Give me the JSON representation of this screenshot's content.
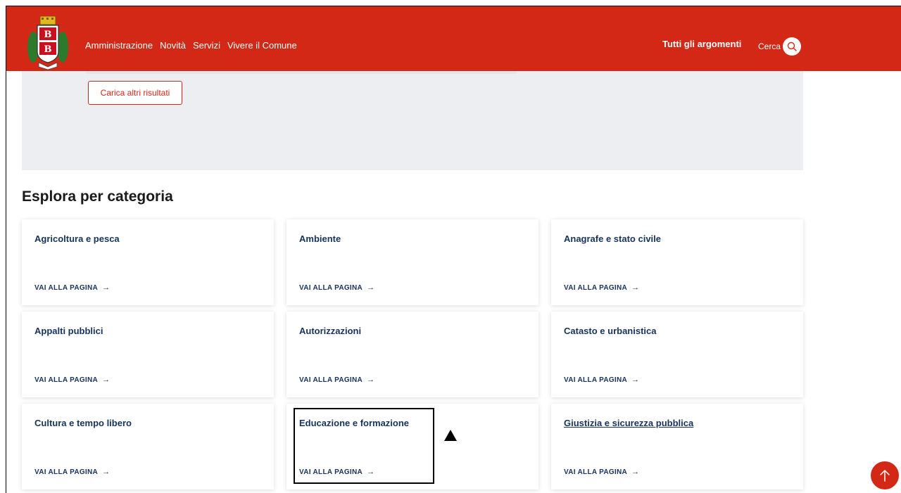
{
  "header": {
    "nav": [
      "Amministrazione",
      "Novità",
      "Servizi",
      "Vivere il Comune"
    ],
    "topics_label": "Tutti gli argomenti",
    "search_label": "Cerca",
    "logo_letters": [
      "B",
      "B"
    ],
    "brand_color": "#d42816"
  },
  "results": {
    "load_more_label": "Carica altri risultati"
  },
  "section_title": "Esplora per categoria",
  "cards": [
    {
      "title": "Agricoltura e pesca",
      "link": "VAI ALLA PAGINA"
    },
    {
      "title": "Ambiente",
      "link": "VAI ALLA PAGINA"
    },
    {
      "title": "Anagrafe e stato civile",
      "link": "VAI ALLA PAGINA"
    },
    {
      "title": "Appalti pubblici",
      "link": "VAI ALLA PAGINA"
    },
    {
      "title": "Autorizzazioni",
      "link": "VAI ALLA PAGINA"
    },
    {
      "title": "Catasto e urbanistica",
      "link": "VAI ALLA PAGINA"
    },
    {
      "title": "Cultura e tempo libero",
      "link": "VAI ALLA PAGINA"
    },
    {
      "title": "Educazione e formazione",
      "link": "VAI ALLA PAGINA"
    },
    {
      "title": "Giustizia e sicurezza pubblica",
      "link": "VAI ALLA PAGINA"
    }
  ],
  "icons": {
    "arrow": "→",
    "search": "search-icon",
    "scroll_top": "arrow-up-icon"
  }
}
